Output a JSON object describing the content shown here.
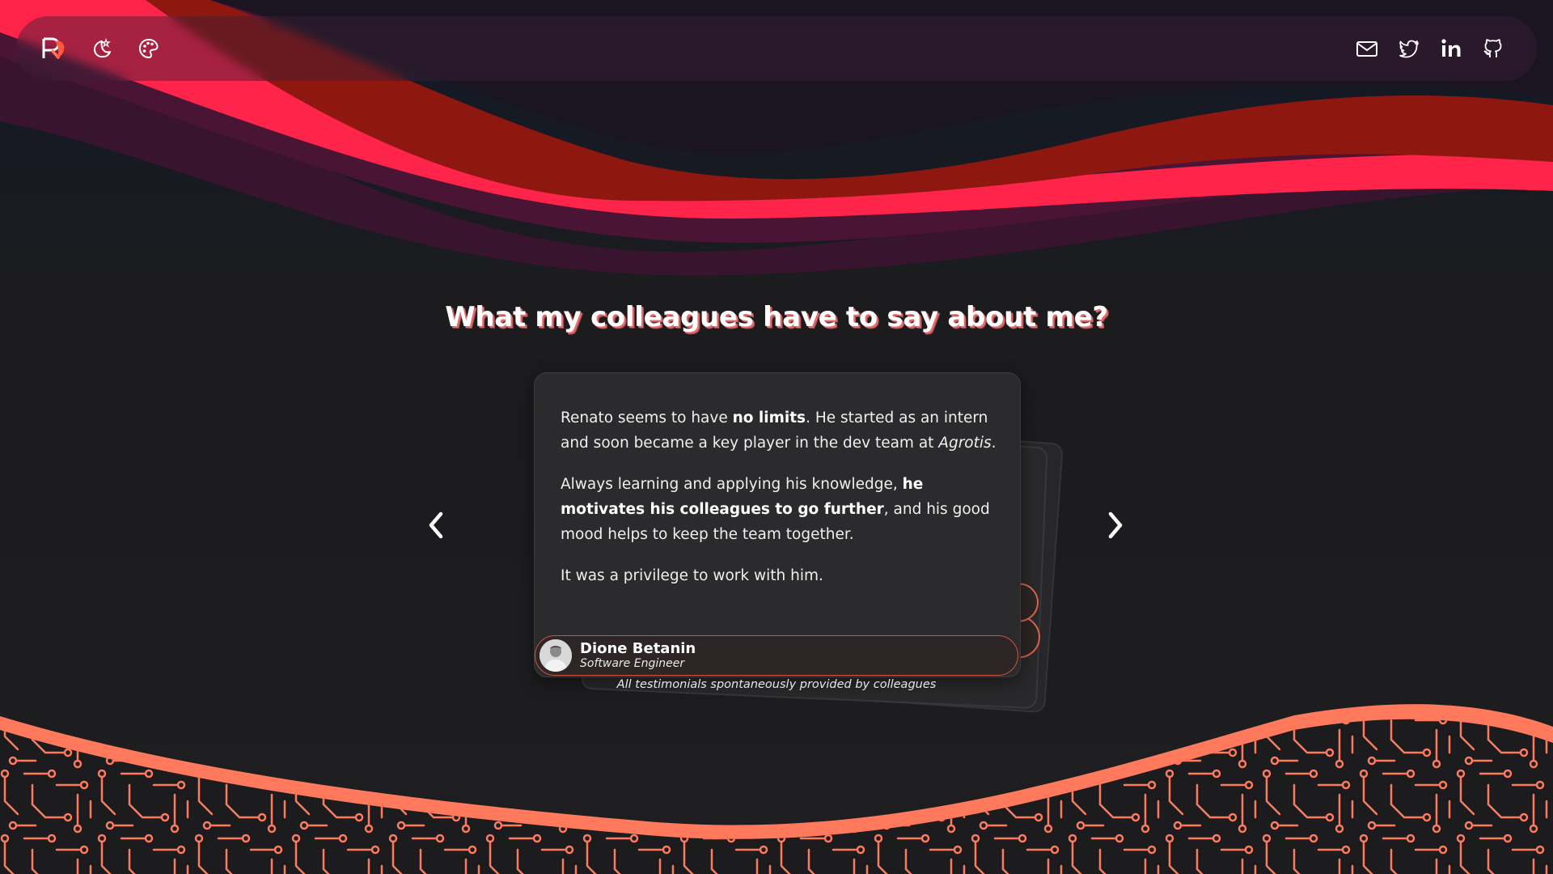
{
  "nav": {
    "logo_icon": "logo-r-icon",
    "theme_icon": "moon-stars-icon",
    "palette_icon": "palette-icon",
    "social": [
      {
        "name": "email",
        "icon": "mail-icon"
      },
      {
        "name": "twitter",
        "icon": "twitter-icon"
      },
      {
        "name": "linkedin",
        "icon": "linkedin-icon"
      },
      {
        "name": "github",
        "icon": "github-icon"
      }
    ]
  },
  "section": {
    "title": "What my colleagues have to say about me?"
  },
  "testimonial": {
    "p1_a": "Renato seems to have ",
    "p1_b": "no limits",
    "p1_c": ". He started as an intern and soon became a key player in the dev team at ",
    "p1_d": "Agrotis",
    "p1_e": ".",
    "p2_a": "Always learning and applying his knowledge, ",
    "p2_b": "he motivates his colleagues to go further",
    "p2_c": ", and his good mood helps to keep the team together.",
    "p3": "It was a privilege to work with him.",
    "author_name": "Dione Betanin",
    "author_role": "Software Engineer"
  },
  "footnote": "All testimonials spontaneously provided by colleagues",
  "colors": {
    "accent_red": "#ff2449",
    "dark_red": "#8e1710",
    "purple": "#4a1535",
    "orange": "#ff7a5c",
    "background": "#1c1c1e"
  }
}
